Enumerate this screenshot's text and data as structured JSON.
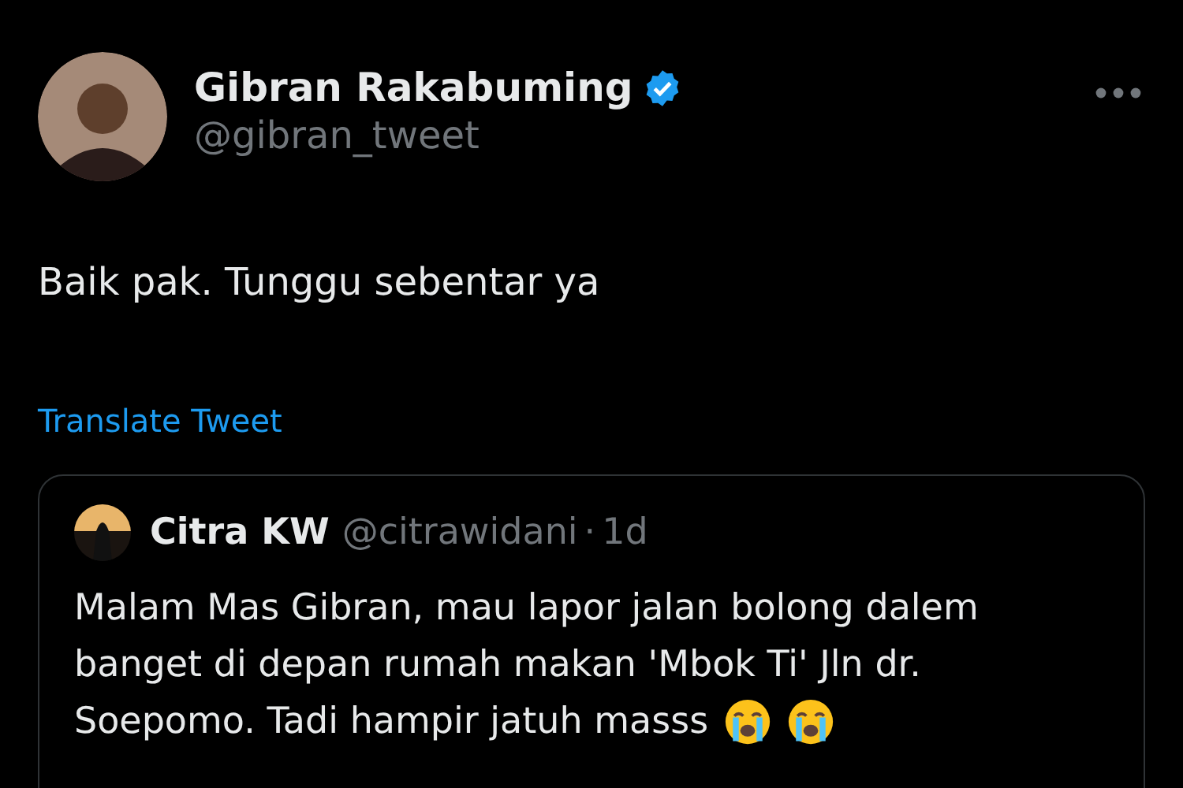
{
  "author": {
    "name": "Gibran Rakabuming",
    "verified": true,
    "handle": "@gibran_tweet"
  },
  "tweet": {
    "text": "Baik pak. Tunggu sebentar ya",
    "translate_link": "Translate Tweet"
  },
  "quoted_tweet": {
    "name": "Citra KW",
    "handle": "@citrawidani",
    "separator": "·",
    "time": "1d",
    "text_lines": [
      "Malam Mas Gibran, mau lapor jalan bolong dalem",
      "banget di depan rumah makan 'Mbok Ti' Jln dr.",
      "Soepomo. Tadi hampir jatuh masss"
    ]
  }
}
